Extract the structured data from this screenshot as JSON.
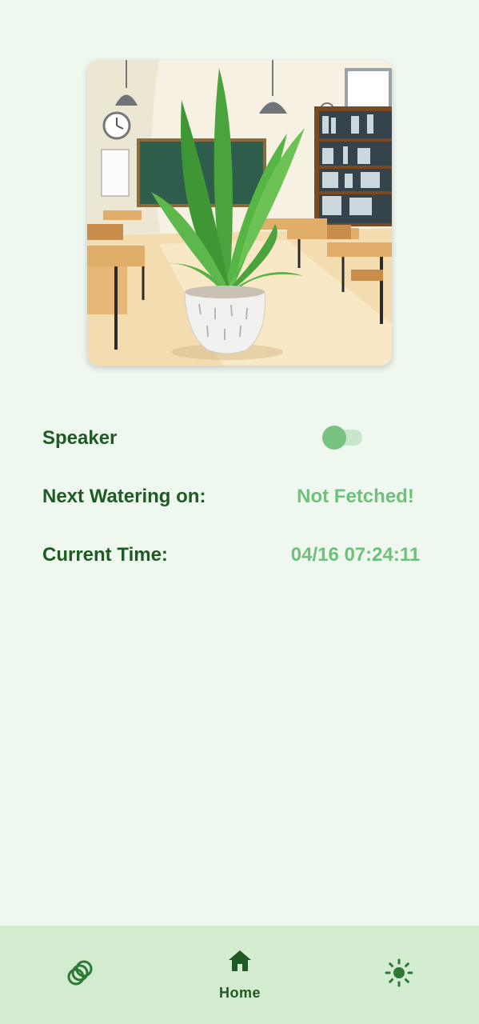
{
  "hero": {
    "image": "plant-in-classroom-illustration"
  },
  "settings": {
    "speaker_label": "Speaker",
    "speaker_on": false,
    "next_watering_label": "Next Watering on:",
    "next_watering_value": "Not Fetched!",
    "current_time_label": "Current Time:",
    "current_time_value": "04/16 07:24:11"
  },
  "nav": {
    "items": [
      {
        "icon": "rings-icon",
        "label": ""
      },
      {
        "icon": "home-icon",
        "label": "Home"
      },
      {
        "icon": "sun-icon",
        "label": ""
      }
    ],
    "selected": "Home"
  },
  "colors": {
    "background": "#eef8ef",
    "label": "#1f5a25",
    "value": "#6ec07a",
    "nav_bg": "#d3ecd0",
    "toggle_thumb": "#79c282",
    "toggle_track": "#c8e6cb"
  }
}
